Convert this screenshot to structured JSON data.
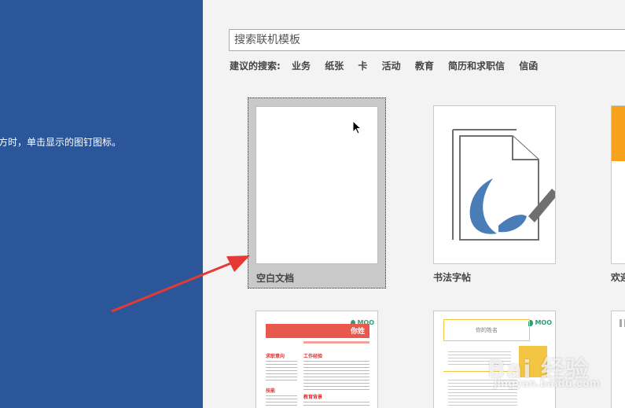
{
  "left_pane": {
    "hint_text": "方时，单击显示的图钉图标。"
  },
  "search": {
    "placeholder": "搜索联机模板"
  },
  "suggestions": {
    "label": "建议的搜索:",
    "items": [
      "业务",
      "纸张",
      "卡",
      "活动",
      "教育",
      "简历和求职信",
      "信函"
    ]
  },
  "templates": {
    "blank": {
      "label": "空白文档"
    },
    "calligraphy": {
      "label": "书法字帖"
    },
    "welcome": {
      "label": "欢迎"
    }
  },
  "resume1": {
    "brand": "MOO",
    "header": "你姓",
    "sections": [
      "求职意向",
      "工作经验",
      "技能",
      "教育背景"
    ]
  },
  "resume2": {
    "brand": "MOO",
    "name_placeholder": "你的姓名"
  },
  "watermark": {
    "main": "Bai 经验",
    "sub": "jingyan.baidu.com"
  },
  "colors": {
    "left_pane": "#2b579a",
    "arrow": "#e53935",
    "resume_red": "#e8584c",
    "moo_green": "#2e9e77",
    "resume_yellow": "#f4c542"
  }
}
